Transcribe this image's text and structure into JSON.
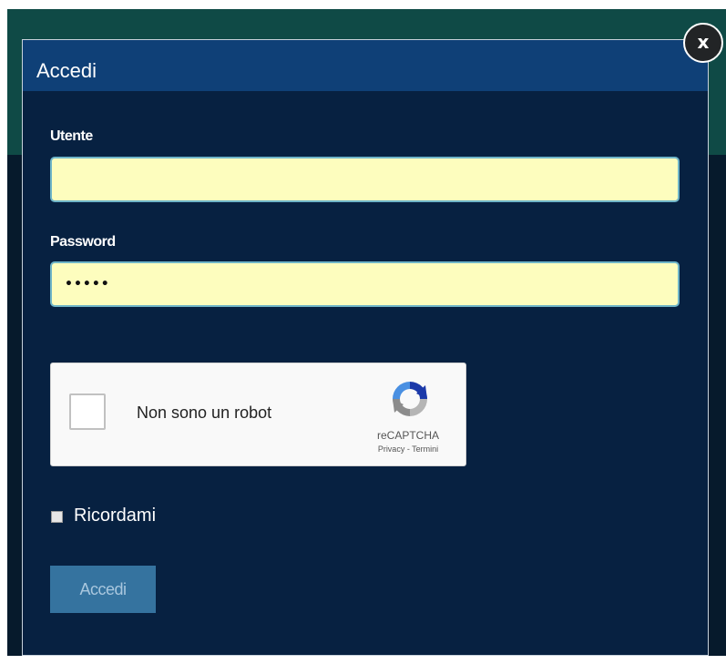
{
  "modal": {
    "title": "Accedi",
    "close_label": "x"
  },
  "form": {
    "username": {
      "label": "Utente",
      "value": ""
    },
    "password": {
      "label": "Password",
      "value": "•••••"
    },
    "recaptcha": {
      "checkbox_label": "Non sono un robot",
      "brand": "reCAPTCHA",
      "links": "Privacy - Termini"
    },
    "remember": {
      "label": "Ricordami",
      "checked": false
    },
    "submit_label": "Accedi"
  },
  "icons": {
    "close": "close-icon",
    "recaptcha_logo": "recaptcha-logo-icon"
  },
  "colors": {
    "modal_header": "#0f4077",
    "modal_body": "#072141",
    "input_background": "#fdfdbe",
    "submit_button": "#35739f",
    "page_header": "#0f4a46"
  }
}
